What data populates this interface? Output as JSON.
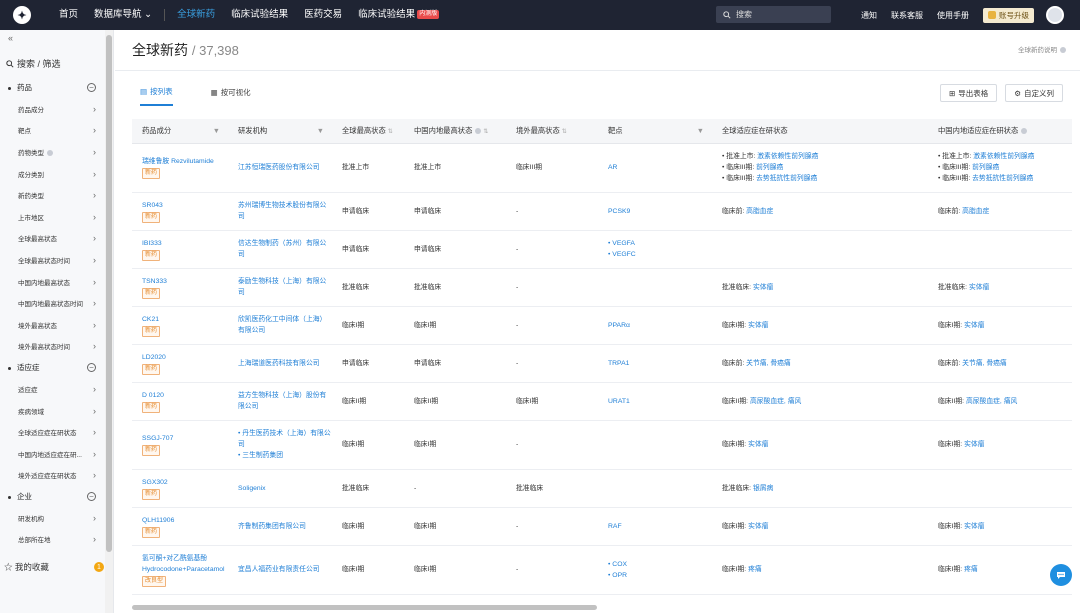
{
  "topbar": {
    "logo_glyph": "✦",
    "nav": [
      {
        "label": "首页",
        "active": false,
        "hot": ""
      },
      {
        "label": "数据库导航 ⌄",
        "active": false,
        "hot": ""
      },
      {
        "label": "全球新药",
        "active": true,
        "hot": ""
      },
      {
        "label": "临床试验结果",
        "active": false,
        "hot": ""
      },
      {
        "label": "医药交易",
        "active": false,
        "hot": ""
      },
      {
        "label": "临床试验结果",
        "active": false,
        "hot": "内测版"
      }
    ],
    "search_placeholder": "搜索",
    "links": [
      "通知",
      "联系客服",
      "使用手册"
    ],
    "upgrade_label": "账号升级"
  },
  "sidebar": {
    "collapse_glyph": "«",
    "title": "搜索 / 筛选",
    "groups": [
      {
        "label": "药品",
        "items": [
          "药品成分",
          "靶点",
          "药物类型",
          "成分类别",
          "新药类型",
          "上市地区",
          "全球最高状态",
          "全球最高状态时间",
          "中国内地最高状态",
          "中国内地最高状态时间",
          "境外最高状态",
          "境外最高状态时间"
        ]
      },
      {
        "label": "适应症",
        "items": [
          "适应症",
          "疾病领域",
          "全球适应症在研状态",
          "中国内地适应症在研...",
          "境外适应症在研状态"
        ]
      },
      {
        "label": "企业",
        "items": [
          "研发机构",
          "总部所在地"
        ]
      }
    ],
    "favorites_label": "我的收藏",
    "favorites_count": "1"
  },
  "main": {
    "title": "全球新药",
    "count": "/ 37,398",
    "explain": "全球新药说明",
    "tabs": [
      "按列表",
      "按可视化"
    ],
    "export_label": "导出表格",
    "custom_label": "自定义列"
  },
  "table": {
    "headers": [
      "药品成分",
      "研发机构",
      "全球最高状态",
      "中国内地最高状态",
      "境外最高状态",
      "靶点",
      "全球适应症在研状态",
      "中国内地适应症在研状态"
    ],
    "rows": [
      {
        "drug": "瑞维鲁胺 Rezvilutamide",
        "tag": "新药",
        "org": [
          "江苏恒瑞医药股份有限公司"
        ],
        "g": "批准上市",
        "cn": "批准上市",
        "os": "临床III期",
        "target": [
          "AR"
        ],
        "gi": [
          [
            "批准上市: ",
            "激素依赖性前列腺癌"
          ],
          [
            "临床III期: ",
            "前列腺癌"
          ],
          [
            "临床III期: ",
            "去势抵抗性前列腺癌"
          ]
        ],
        "ci": [
          [
            "批准上市: ",
            "激素依赖性前列腺癌"
          ],
          [
            "临床III期: ",
            "前列腺癌"
          ],
          [
            "临床III期: ",
            "去势抵抗性前列腺癌"
          ]
        ]
      },
      {
        "drug": "SR043",
        "tag": "新药",
        "org": [
          "苏州瑞博生物技术股份有限公司"
        ],
        "g": "申请临床",
        "cn": "申请临床",
        "os": "-",
        "target": [
          "PCSK9"
        ],
        "gi": [
          [
            "临床前: ",
            "高脂血症"
          ]
        ],
        "ci": [
          [
            "临床前: ",
            "高脂血症"
          ]
        ]
      },
      {
        "drug": "IBI333",
        "tag": "新药",
        "org": [
          "信达生物制药（苏州）有限公司"
        ],
        "g": "申请临床",
        "cn": "申请临床",
        "os": "-",
        "target": [
          "VEGFA",
          "VEGFC"
        ],
        "gi": [],
        "ci": []
      },
      {
        "drug": "TSN333",
        "tag": "新药",
        "org": [
          "泰励生物科技（上海）有限公司"
        ],
        "g": "批准临床",
        "cn": "批准临床",
        "os": "-",
        "target": [],
        "gi": [
          [
            "批准临床: ",
            "实体瘤"
          ]
        ],
        "ci": [
          [
            "批准临床: ",
            "实体瘤"
          ]
        ]
      },
      {
        "drug": "CK21",
        "tag": "新药",
        "org": [
          "欣凯医药化工中间体（上海）有限公司"
        ],
        "g": "临床I期",
        "cn": "临床I期",
        "os": "-",
        "target": [
          "PPARα"
        ],
        "gi": [
          [
            "临床I期: ",
            "实体瘤"
          ]
        ],
        "ci": [
          [
            "临床I期: ",
            "实体瘤"
          ]
        ]
      },
      {
        "drug": "LD2020",
        "tag": "新药",
        "org": [
          "上海瑞道医药科技有限公司"
        ],
        "g": "申请临床",
        "cn": "申请临床",
        "os": "-",
        "target": [
          "TRPA1"
        ],
        "gi": [
          [
            "临床前: ",
            "关节痛, 骨癌痛"
          ]
        ],
        "ci": [
          [
            "临床前: ",
            "关节痛, 骨癌痛"
          ]
        ]
      },
      {
        "drug": "D 0120",
        "tag": "新药",
        "org": [
          "益方生物科技（上海）股份有限公司"
        ],
        "g": "临床II期",
        "cn": "临床II期",
        "os": "临床I期",
        "target": [
          "URAT1"
        ],
        "gi": [
          [
            "临床II期: ",
            "高尿酸血症, 痛风"
          ]
        ],
        "ci": [
          [
            "临床II期: ",
            "高尿酸血症, 痛风"
          ]
        ]
      },
      {
        "drug": "SSGJ-707",
        "tag": "新药",
        "org": [
          "丹生医药技术（上海）有限公司",
          "三生制药集团"
        ],
        "g": "临床I期",
        "cn": "临床I期",
        "os": "-",
        "target": [],
        "gi": [
          [
            "临床I期: ",
            "实体瘤"
          ]
        ],
        "ci": [
          [
            "临床I期: ",
            "实体瘤"
          ]
        ]
      },
      {
        "drug": "SGX302",
        "tag": "新药",
        "org": [
          "Soligenix"
        ],
        "g": "批准临床",
        "cn": "-",
        "os": "批准临床",
        "target": [],
        "gi": [
          [
            "批准临床: ",
            "银屑病"
          ]
        ],
        "ci": []
      },
      {
        "drug": "QLH11906",
        "tag": "新药",
        "org": [
          "齐鲁制药集团有限公司"
        ],
        "g": "临床I期",
        "cn": "临床I期",
        "os": "-",
        "target": [
          "RAF"
        ],
        "gi": [
          [
            "临床I期: ",
            "实体瘤"
          ]
        ],
        "ci": [
          [
            "临床I期: ",
            "实体瘤"
          ]
        ]
      },
      {
        "drug": "氢可酮+对乙酰氨基酚 Hydrocodone+Paracetamol",
        "tag": "改良型",
        "org": [
          "宜昌人福药业有限责任公司"
        ],
        "g": "临床I期",
        "cn": "临床I期",
        "os": "-",
        "target": [
          "COX",
          "OPR"
        ],
        "gi": [
          [
            "临床I期: ",
            "疼痛"
          ]
        ],
        "ci": [
          [
            "临床I期: ",
            "疼痛"
          ]
        ]
      }
    ]
  },
  "colors": {
    "topbar": "#1f2433",
    "accent": "#1f7fd6",
    "tag": "#e58a2b"
  }
}
